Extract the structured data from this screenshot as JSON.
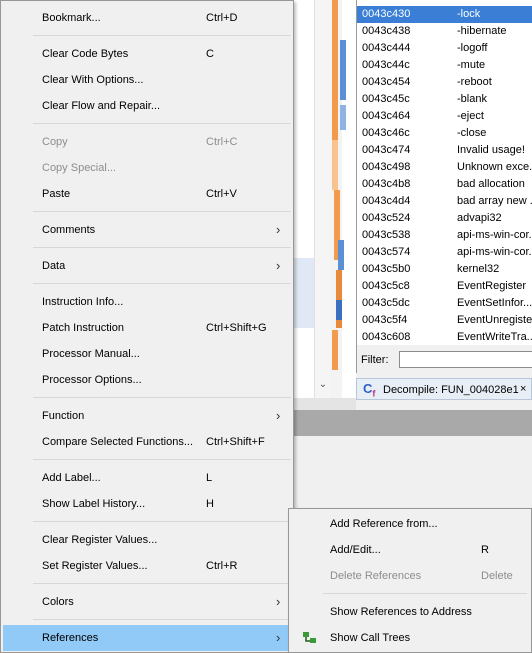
{
  "strings_table": {
    "rows": [
      {
        "addr": "0043c430",
        "value": "-lock",
        "selected": true
      },
      {
        "addr": "0043c438",
        "value": "-hibernate"
      },
      {
        "addr": "0043c444",
        "value": "-logoff"
      },
      {
        "addr": "0043c44c",
        "value": "-mute"
      },
      {
        "addr": "0043c454",
        "value": "-reboot"
      },
      {
        "addr": "0043c45c",
        "value": "-blank"
      },
      {
        "addr": "0043c464",
        "value": "-eject"
      },
      {
        "addr": "0043c46c",
        "value": "-close"
      },
      {
        "addr": "0043c474",
        "value": "Invalid usage!"
      },
      {
        "addr": "0043c498",
        "value": "Unknown exce..."
      },
      {
        "addr": "0043c4b8",
        "value": "bad allocation"
      },
      {
        "addr": "0043c4d4",
        "value": "bad array new ..."
      },
      {
        "addr": "0043c524",
        "value": "advapi32"
      },
      {
        "addr": "0043c538",
        "value": "api-ms-win-cor..."
      },
      {
        "addr": "0043c574",
        "value": "api-ms-win-cor..."
      },
      {
        "addr": "0043c5b0",
        "value": "kernel32"
      },
      {
        "addr": "0043c5c8",
        "value": "EventRegister"
      },
      {
        "addr": "0043c5dc",
        "value": "EventSetInfor..."
      },
      {
        "addr": "0043c5f4",
        "value": "EventUnregister"
      },
      {
        "addr": "0043c608",
        "value": "EventWriteTra..."
      }
    ],
    "filter_label": "Filter:",
    "filter_value": ""
  },
  "decompile_tab": {
    "label": "Decompile: FUN_004028e1",
    "close": "×",
    "icon": "decompiler-icon"
  },
  "context_menu": {
    "items": [
      {
        "label": "Bookmark...",
        "shortcut": "Ctrl+D"
      },
      {
        "label": "Clear Code Bytes",
        "shortcut": "C"
      },
      {
        "label": "Clear With Options...",
        "shortcut": ""
      },
      {
        "label": "Clear Flow and Repair...",
        "shortcut": ""
      },
      {
        "label": "Copy",
        "shortcut": "Ctrl+C",
        "disabled": true
      },
      {
        "label": "Copy Special...",
        "shortcut": "",
        "disabled": true
      },
      {
        "label": "Paste",
        "shortcut": "Ctrl+V"
      },
      {
        "label": "Comments",
        "shortcut": "",
        "submenu": true
      },
      {
        "label": "Data",
        "shortcut": "",
        "submenu": true
      },
      {
        "label": "Instruction Info...",
        "shortcut": ""
      },
      {
        "label": "Patch Instruction",
        "shortcut": "Ctrl+Shift+G"
      },
      {
        "label": "Processor Manual...",
        "shortcut": ""
      },
      {
        "label": "Processor Options...",
        "shortcut": ""
      },
      {
        "label": "Function",
        "shortcut": "",
        "submenu": true
      },
      {
        "label": "Compare Selected Functions...",
        "shortcut": "Ctrl+Shift+F"
      },
      {
        "label": "Add Label...",
        "shortcut": "L"
      },
      {
        "label": "Show Label History...",
        "shortcut": "H"
      },
      {
        "label": "Clear Register Values...",
        "shortcut": ""
      },
      {
        "label": "Set Register Values...",
        "shortcut": "Ctrl+R"
      },
      {
        "label": "Colors",
        "shortcut": "",
        "submenu": true
      },
      {
        "label": "References",
        "shortcut": "",
        "submenu": true,
        "highlighted": true
      }
    ],
    "submenu_arrow": "›"
  },
  "references_submenu": {
    "items": [
      {
        "label": "Add Reference from...",
        "shortcut": ""
      },
      {
        "label": "Add/Edit...",
        "shortcut": "R"
      },
      {
        "label": "Delete References",
        "shortcut": "Delete",
        "disabled": true
      },
      {
        "label": "Show References to Address",
        "shortcut": ""
      },
      {
        "label": "Show Call Trees",
        "shortcut": "",
        "icon": "call-tree-icon"
      }
    ]
  },
  "scroll_arrow": "⌄",
  "colors": {
    "menu_bg": "#f0f0f0",
    "menu_highlight": "#91c9f7",
    "selection": "#3a7fd5",
    "disabled_text": "#8d8d8d",
    "mark_orange": "#f29b4c",
    "mark_blue": "#5b8fd6"
  }
}
